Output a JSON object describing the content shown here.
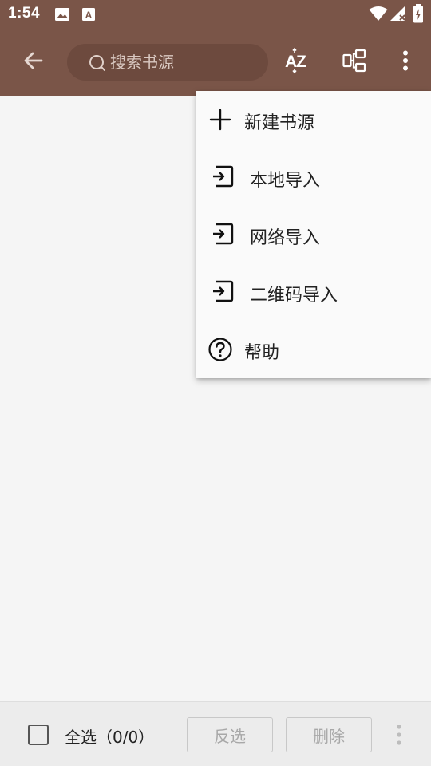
{
  "status_bar": {
    "time": "1:54",
    "left_icons": [
      "image-icon",
      "text-icon"
    ],
    "right_icons": [
      "wifi-icon",
      "signal-icon",
      "battery-icon"
    ]
  },
  "toolbar": {
    "back_icon": "arrow-left-icon",
    "search": {
      "placeholder": "搜索书源",
      "value": ""
    },
    "actions": [
      "sort-az-icon",
      "group-icon",
      "more-vertical-icon"
    ]
  },
  "menu": {
    "items": [
      {
        "label": "新建书源",
        "icon": "plus-icon"
      },
      {
        "label": "本地导入",
        "icon": "import-icon"
      },
      {
        "label": "网络导入",
        "icon": "import-icon"
      },
      {
        "label": "二维码导入",
        "icon": "import-icon"
      },
      {
        "label": "帮助",
        "icon": "help-circle-icon"
      }
    ]
  },
  "bottom_bar": {
    "select_all_label": "全选（0/0）",
    "select_all_checked": false,
    "invert_label": "反选",
    "delete_label": "删除",
    "more_icon": "more-vertical-icon"
  },
  "colors": {
    "app_bar": "#7a5548",
    "search_bg": "#6d4a3e",
    "background": "#f5f5f5",
    "menu_bg": "#fafafa",
    "bottom_bar": "#ececec",
    "disabled_text": "#a8a8a8"
  }
}
